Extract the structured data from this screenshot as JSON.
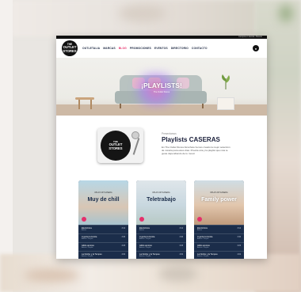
{
  "page": {
    "topbar_text": "Compra en tienda ▪ Buscar",
    "logo_lines": [
      "THE",
      "OUTLET",
      "STORES"
    ]
  },
  "nav": {
    "items": [
      "OUTLETALIA",
      "MARCAS",
      "BLOG",
      "PROMOCIONES",
      "EVENTOS",
      "DIRECTORIO",
      "CONTACTO"
    ],
    "active_index": 2
  },
  "hero": {
    "title": "¡PLAYLISTS!",
    "subtitle": "The Outlet Stores"
  },
  "intro": {
    "kicker": "Presentamos",
    "title": "Playlists CASERAS",
    "body": "En The Outlet Stores Alcochete hemos creado la mejor selección de música para estos días. Prueba otra y la playlist que más te guste dependiendo de tu mood."
  },
  "playlists": [
    {
      "label": "#PLAYLISTCASERA",
      "title": "Muy de chill",
      "title_light": false,
      "tracks": [
        {
          "title": "Electrónica",
          "artist": "Artista",
          "time": "3:12"
        },
        {
          "title": "A gente la bonita",
          "artist": "Artista ▪ Playlist",
          "time": "3:40"
        },
        {
          "title": "Adiós amores",
          "artist": "Artista ▪ Playlist",
          "time": "3:26"
        },
        {
          "title": "La Noche y la Tempes",
          "artist": "Artista ▪ Playlist",
          "time": "4:02"
        }
      ]
    },
    {
      "label": "#PLAYLISTCASERA",
      "title": "Teletrabajo",
      "title_light": false,
      "tracks": [
        {
          "title": "Electrónica",
          "artist": "Artista",
          "time": "3:12"
        },
        {
          "title": "A gente la bonita",
          "artist": "Artista ▪ Playlist",
          "time": "3:40"
        },
        {
          "title": "Adiós amores",
          "artist": "Artista ▪ Playlist",
          "time": "3:26"
        },
        {
          "title": "La Noche y la Tempes",
          "artist": "Artista ▪ Playlist",
          "time": "4:02"
        }
      ]
    },
    {
      "label": "#PLAYLISTCASERA",
      "title": "Family power",
      "title_light": true,
      "tracks": [
        {
          "title": "Electrónica",
          "artist": "Artista",
          "time": "3:12"
        },
        {
          "title": "A gente la bonita",
          "artist": "Artista ▪ Playlist",
          "time": "3:40"
        },
        {
          "title": "Adiós amores",
          "artist": "Artista ▪ Playlist",
          "time": "3:26"
        },
        {
          "title": "La Noche y la Tempes",
          "artist": "Artista ▪ Playlist",
          "time": "4:02"
        }
      ]
    }
  ],
  "colors": {
    "accent": "#e5306b",
    "navy": "#1b2d4a",
    "logo_bg": "#111111"
  },
  "icons": {
    "cart": "shopping-bag-icon",
    "play": "play-icon"
  }
}
